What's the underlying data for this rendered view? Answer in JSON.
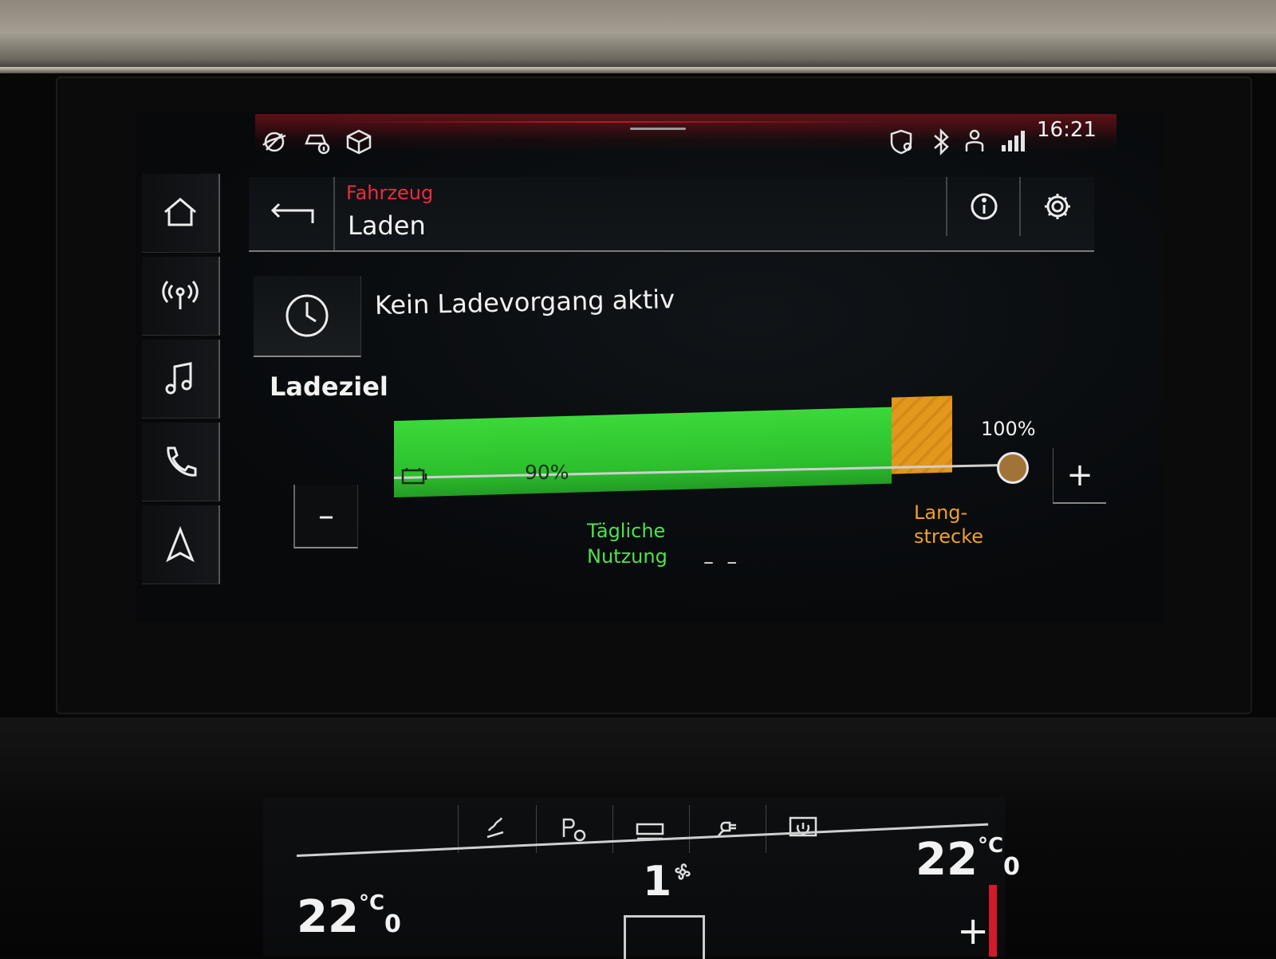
{
  "status_bar": {
    "time": "16:21",
    "icons": [
      "connectivity-icon",
      "vehicle-info-icon",
      "package-icon",
      "location-privacy-icon",
      "bluetooth-icon",
      "user-profile-icon",
      "lte-signal-icon"
    ]
  },
  "nav": {
    "items": [
      {
        "name": "home",
        "icon": "home-icon"
      },
      {
        "name": "radio",
        "icon": "radio-antenna-icon"
      },
      {
        "name": "media",
        "icon": "music-note-icon"
      },
      {
        "name": "phone",
        "icon": "phone-icon"
      },
      {
        "name": "navigation",
        "icon": "navigation-arrow-icon"
      }
    ]
  },
  "header": {
    "breadcrumb": "Fahrzeug",
    "title": "Laden",
    "buttons": [
      "info-icon",
      "gear-icon"
    ]
  },
  "charge": {
    "status": "Kein Ladevorgang aktiv",
    "section_title": "Ladeziel",
    "target_value": "90%",
    "target_fraction": 0.9,
    "max_label": "100%",
    "daily_label_line1": "Tägliche",
    "daily_label_line2": "Nutzung",
    "long_label_line1": "Lang-",
    "long_label_line2": "strecke",
    "dashes": "– –",
    "minus_label": "–",
    "plus_label": "+"
  },
  "climate": {
    "temp_left_main": "22",
    "temp_left_unit": "°C",
    "temp_left_dec": "0",
    "temp_right_main": "22",
    "temp_right_unit": "°C",
    "temp_right_dec": "0",
    "fan_level": "1",
    "plus_label": "+",
    "tabs": [
      "seat-heating-icon",
      "park-assist-icon",
      "rear-defrost-icon",
      "charge-plug-icon",
      "climate-power-icon"
    ]
  },
  "colors": {
    "accent_red": "#ef2b3b",
    "daily_green": "#3cd83a",
    "long_orange": "#e3971c"
  }
}
